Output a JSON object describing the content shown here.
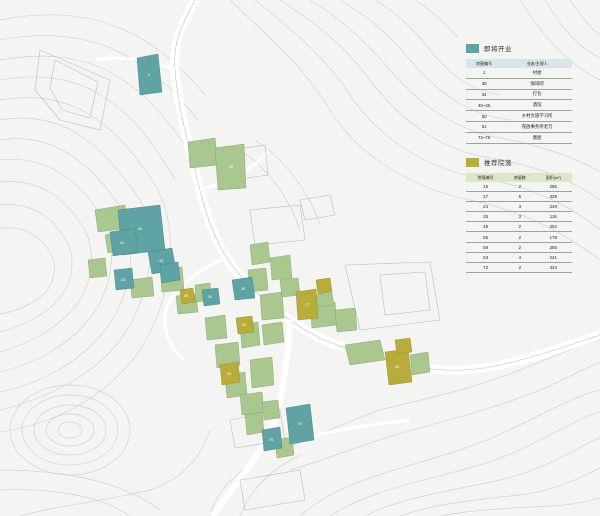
{
  "colors": {
    "operating": "#5fa3a4",
    "recommended": "#b8ad3a",
    "residential": "#a9c78f",
    "road": "#ffffff",
    "contour": "#cfd2cf"
  },
  "legend_operating": {
    "title": "即将开业",
    "headers": [
      "房屋编号",
      "业态/主理人"
    ],
    "rows": [
      [
        "1",
        "村委"
      ],
      [
        "30",
        "咖啡吧"
      ],
      [
        "34",
        "打包"
      ],
      [
        "40~45",
        "酒馆"
      ],
      [
        "50",
        "乡村文旅学习所"
      ],
      [
        "51",
        "夜放事务所老万"
      ],
      [
        "74~75",
        "墨屋"
      ]
    ]
  },
  "legend_recommended": {
    "title": "推荐院落",
    "headers": [
      "院落编号",
      "房屋数",
      "面积(m²)"
    ],
    "rows": [
      [
        "16",
        "2",
        "296"
      ],
      [
        "17",
        "5",
        "328"
      ],
      [
        "24",
        "3",
        "249"
      ],
      [
        "25",
        "3",
        "116"
      ],
      [
        "49",
        "2",
        "252"
      ],
      [
        "55",
        "2",
        "178"
      ],
      [
        "58",
        "2",
        "285"
      ],
      [
        "63",
        "4",
        "241"
      ],
      [
        "72",
        "2",
        "334"
      ]
    ]
  }
}
